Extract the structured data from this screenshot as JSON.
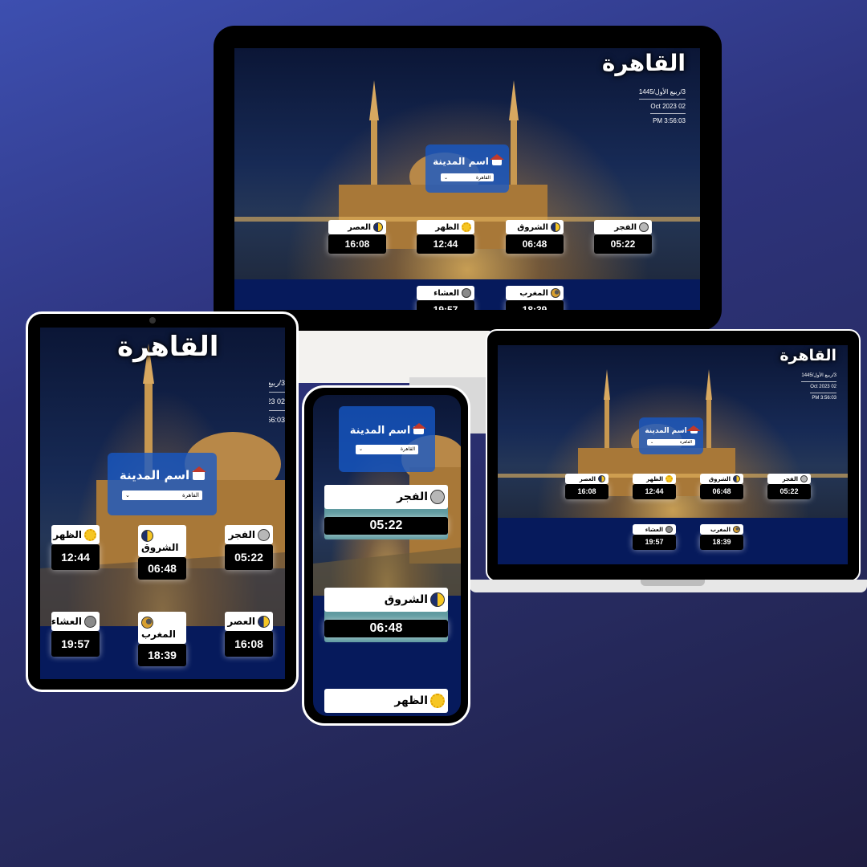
{
  "city": "القاهرة",
  "hijri_date": "3/ربيع الأول/1445",
  "gregorian_date": "Oct 2023 02",
  "time": "PM 3:56:03",
  "select_label": "اسم المدينة",
  "selected_city": "القاهرة",
  "prayers": {
    "fajr": {
      "name": "الفجر",
      "time": "05:22",
      "icon": "moon-icon"
    },
    "sunrise": {
      "name": "الشروق",
      "time": "06:48",
      "icon": "half-sun-icon"
    },
    "dhuhr": {
      "name": "الظهر",
      "time": "12:44",
      "icon": "sun-icon"
    },
    "asr": {
      "name": "العصر",
      "time": "16:08",
      "icon": "half-sun-icon"
    },
    "maghrib": {
      "name": "المغرب",
      "time": "18:39",
      "icon": "sunset-icon"
    },
    "isha": {
      "name": "العشاء",
      "time": "19:57",
      "icon": "night-icon"
    }
  },
  "colors": {
    "background": "#2e347e",
    "select_box": "#1658c8",
    "lower_panel": "#061a5c"
  }
}
